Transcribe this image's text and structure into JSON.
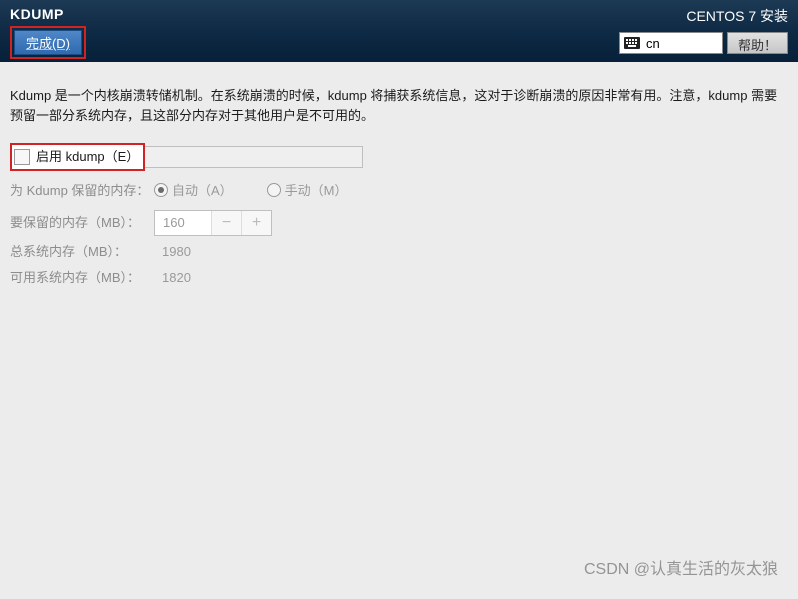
{
  "header": {
    "title": "KDUMP",
    "done_label": "完成(D)",
    "install_title": "CENTOS 7 安装",
    "lang": "cn",
    "help_label": "帮助！"
  },
  "body": {
    "description": "Kdump 是一个内核崩溃转储机制。在系统崩溃的时候，kdump 将捕获系统信息，这对于诊断崩溃的原因非常有用。注意，kdump 需要预留一部分系统内存，且这部分内存对于其他用户是不可用的。",
    "enable_label": "启用 kdump（E）",
    "reserve_label": "为 Kdump 保留的内存：",
    "auto_label": "自动（A）",
    "manual_label": "手动（M）",
    "reserve_mb_label": "要保留的内存（MB）：",
    "reserve_value": "160",
    "total_label": "总系统内存（MB）：",
    "total_value": "1980",
    "avail_label": "可用系统内存（MB）：",
    "avail_value": "1820"
  },
  "watermark": "CSDN @认真生活的灰太狼"
}
